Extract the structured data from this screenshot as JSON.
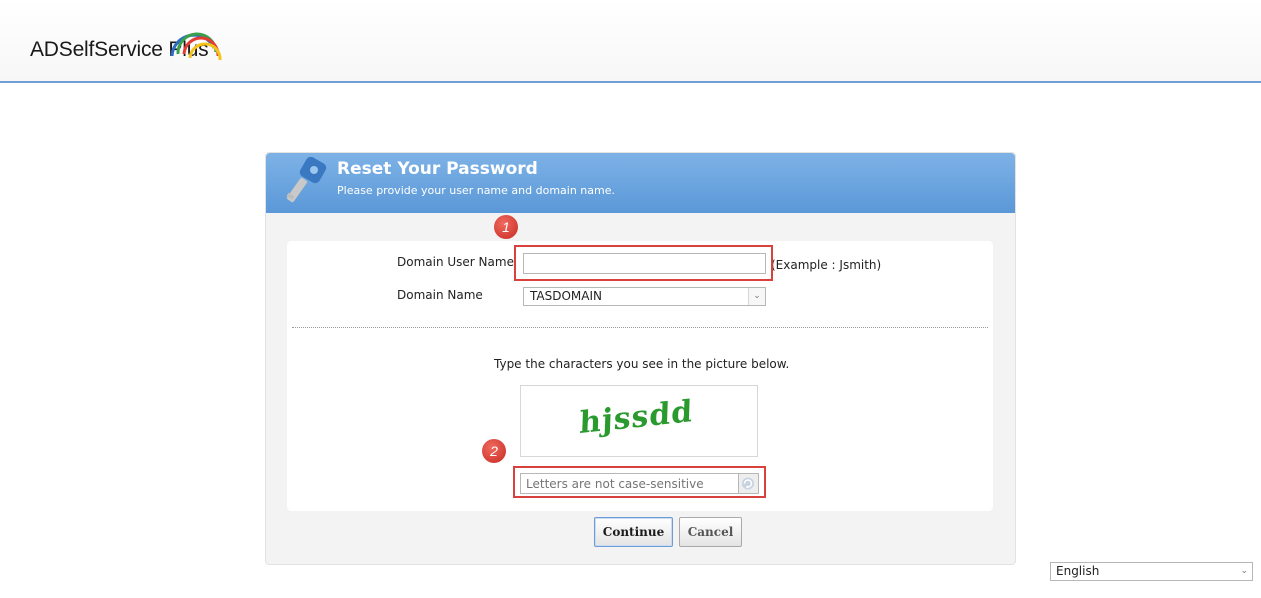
{
  "header": {
    "brand": "ADSelfService Plus"
  },
  "panel": {
    "title": "Reset Your Password",
    "subtitle": "Please provide your user name and domain name."
  },
  "form": {
    "username_label": "Domain User Name",
    "username_value": "",
    "username_example": "(Example : Jsmith)",
    "domain_label": "Domain Name",
    "domain_value": "TASDOMAIN",
    "captcha_instruction": "Type the characters you see in the picture below.",
    "captcha_image_text": "hjssdd",
    "captcha_placeholder": "Letters are not case-sensitive"
  },
  "annotations": {
    "marker_1": "1",
    "marker_2": "2",
    "marker_color": "#d9423c"
  },
  "buttons": {
    "continue": "Continue",
    "cancel": "Cancel"
  },
  "footer": {
    "language": "English"
  },
  "colors": {
    "header_blue": "#6f9fd6",
    "captcha_green": "#2a9a2e"
  },
  "icons": {
    "key": "key-icon",
    "refresh": "refresh-icon",
    "chevron": "chevron-down-icon"
  }
}
